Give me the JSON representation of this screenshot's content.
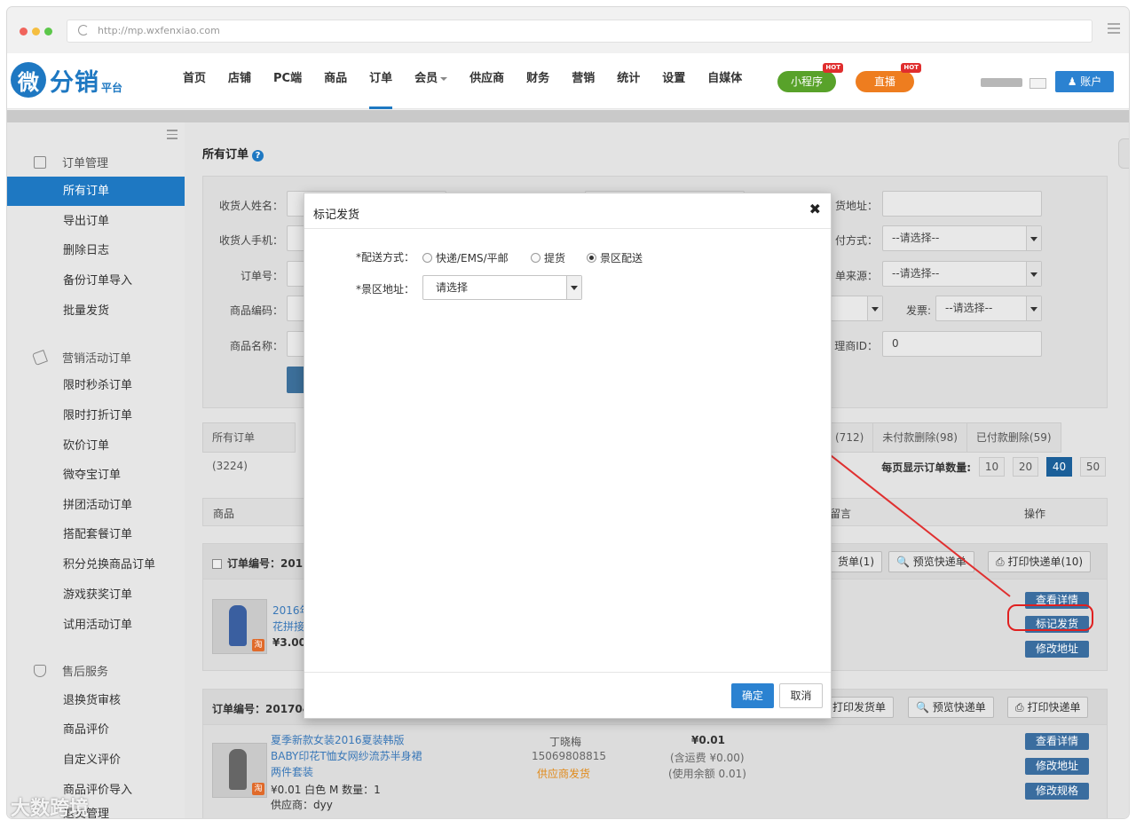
{
  "browser": {
    "url": "http://mp.wxfenxiao.com"
  },
  "logo": {
    "mark": "微",
    "name": "分销",
    "suffix": "平台"
  },
  "topnav": {
    "items": [
      "首页",
      "店铺",
      "PC端",
      "商品",
      "订单",
      "会员",
      "供应商",
      "财务",
      "营销",
      "统计",
      "设置",
      "自媒体"
    ],
    "active": "订单",
    "mini_program": "小程序",
    "live": "直播",
    "hot_badge": "HOT",
    "account": "账户"
  },
  "sidebar": {
    "groups": [
      {
        "title": "订单管理",
        "items": [
          "所有订单",
          "导出订单",
          "删除日志",
          "备份订单导入",
          "批量发货"
        ]
      },
      {
        "title": "营销活动订单",
        "items": [
          "限时秒杀订单",
          "限时打折订单",
          "砍价订单",
          "微夺宝订单",
          "拼团活动订单",
          "搭配套餐订单",
          "积分兑换商品订单",
          "游戏获奖订单",
          "试用活动订单"
        ]
      },
      {
        "title": "售后服务",
        "items": [
          "退换货审核",
          "商品评价",
          "自定义评价",
          "商品评价导入",
          "退货管理"
        ]
      }
    ],
    "active": "所有订单"
  },
  "main": {
    "title": "所有订单",
    "filters": {
      "receiver_name": "收货人姓名：",
      "receiver_phone": "收货人手机：",
      "order_no": "订单号：",
      "product_code": "商品编码：",
      "product_name": "商品名称：",
      "receiver_address": "货地址：",
      "pay_method": "付方式：",
      "pay_method_value": "--请选择--",
      "order_source": "单来源：",
      "order_source_value": "--请选择--",
      "invoice": "发票:",
      "invoice_value": "--请选择--",
      "agent_id": "理商ID：",
      "agent_id_value": "0"
    },
    "tabs": [
      "所有订单(3224)",
      "(712)",
      "未付款删除(98)",
      "已付款删除(59)"
    ],
    "per_page": {
      "label": "每页显示订单数量:",
      "options": [
        "10",
        "20",
        "40",
        "50"
      ],
      "active": "40"
    },
    "columns": {
      "product": "商品",
      "remark": "留言",
      "action": "操作"
    },
    "orders": [
      {
        "order_no": "订单编号：201",
        "buttons": [
          "货单(1)",
          "预览快递单",
          "打印快递单(10)"
        ],
        "title_line1": "2016年",
        "title_line2": "花拼接",
        "price": "¥3.00",
        "actions": [
          "查看详情",
          "标记发货",
          "修改地址"
        ]
      },
      {
        "order_no": "订单编号：201704",
        "buttons": [
          "打印发货单",
          "预览快递单",
          "打印快递单"
        ],
        "title_line1": "夏季新款女装2016夏装韩版",
        "title_line2": "BABY印花T恤女网纱流苏半身裙",
        "title_line3": "两件套装",
        "price_line": "¥0.01  白色 M  数量：1",
        "supplier": "供应商：dyy",
        "buyer_name": "丁晓梅",
        "buyer_phone": "15069808815",
        "ship_by": "供应商发货",
        "amount": "¥0.01",
        "freight": "(含运费 ¥0.00)",
        "balance": "(使用余额 0.01)",
        "actions": [
          "查看详情",
          "修改地址",
          "修改规格"
        ]
      }
    ]
  },
  "modal": {
    "title": "标记发货",
    "close": "✖",
    "delivery_label": "*配送方式：",
    "options": [
      "快递/EMS/平邮",
      "提货",
      "景区配送"
    ],
    "selected": "景区配送",
    "address_label": "*景区地址：",
    "address_value": "请选择",
    "ok": "确定",
    "cancel": "取消"
  },
  "watermark": "大数跨境"
}
